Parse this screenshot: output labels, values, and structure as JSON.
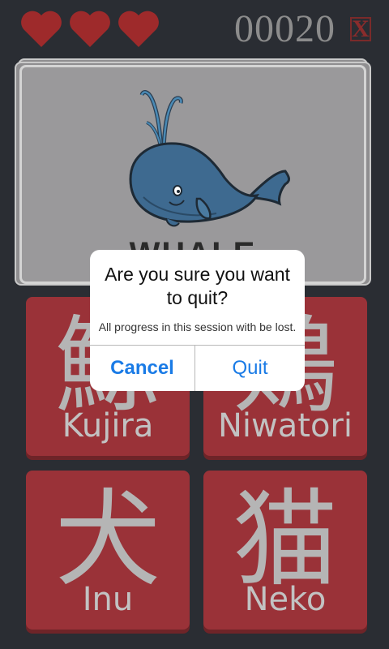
{
  "hud": {
    "lives": 3,
    "lives_max": 3,
    "score": "00020",
    "close_label": "X",
    "heart_color": "#9e2a2b"
  },
  "card": {
    "word": "WHALE",
    "image_icon": "whale-illustration"
  },
  "tiles": [
    {
      "kanji": "鯨",
      "romaji": "Kujira"
    },
    {
      "kanji": "鶏",
      "romaji": "Niwatori"
    },
    {
      "kanji": "犬",
      "romaji": "Inu"
    },
    {
      "kanji": "猫",
      "romaji": "Neko"
    }
  ],
  "dialog": {
    "title": "Are you sure you want to quit?",
    "message": "All progress in this session with be lost.",
    "cancel_label": "Cancel",
    "quit_label": "Quit",
    "accent": "#1a7be6"
  }
}
